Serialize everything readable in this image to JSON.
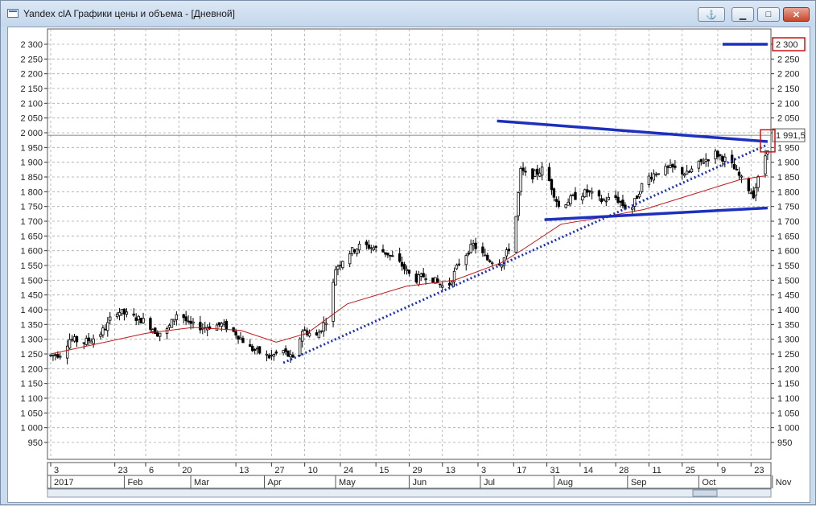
{
  "window": {
    "title": "Yandex clA Графики цены и объема - [Дневной]",
    "buttons": {
      "anchor": "⚓",
      "minimize": "▁",
      "maximize": "□",
      "close": "✕"
    }
  },
  "chart_data": {
    "type": "candlestick",
    "title": "",
    "ylim": [
      950,
      2300
    ],
    "yticks": [
      "2 300",
      "2 250",
      "2 200",
      "2 150",
      "2 100",
      "2 050",
      "2 000",
      "1 950",
      "1 900",
      "1 850",
      "1 800",
      "1 750",
      "1 700",
      "1 650",
      "1 600",
      "1 550",
      "1 500",
      "1 450",
      "1 400",
      "1 350",
      "1 300",
      "1 250",
      "1 200",
      "1 150",
      "1 100",
      "1 050",
      "1 000",
      "950"
    ],
    "ytick_values": [
      2300,
      2250,
      2200,
      2150,
      2100,
      2050,
      2000,
      1950,
      1900,
      1850,
      1800,
      1750,
      1700,
      1650,
      1600,
      1550,
      1500,
      1450,
      1400,
      1350,
      1300,
      1250,
      1200,
      1150,
      1100,
      1050,
      1000,
      950
    ],
    "x_day_labels": [
      "3",
      "23",
      "6",
      "20",
      "13",
      "27",
      "10",
      "24",
      "15",
      "29",
      "13",
      "3",
      "17",
      "31",
      "14",
      "28",
      "11",
      "25",
      "9",
      "23"
    ],
    "x_month_labels": [
      "2017",
      "Feb",
      "Mar",
      "Apr",
      "May",
      "Jun",
      "Jul",
      "Aug",
      "Sep",
      "Oct",
      "Nov"
    ],
    "price_readouts": [
      {
        "label": "1 991,5",
        "value": 1991.5
      },
      {
        "label": "2 300",
        "value": 2300
      }
    ],
    "close_path": [
      {
        "d": 0,
        "v": 1245
      },
      {
        "d": 4,
        "v": 1250
      },
      {
        "d": 8,
        "v": 1300
      },
      {
        "d": 14,
        "v": 1290
      },
      {
        "d": 20,
        "v": 1310
      },
      {
        "d": 24,
        "v": 1350
      },
      {
        "d": 27,
        "v": 1400
      },
      {
        "d": 33,
        "v": 1380
      },
      {
        "d": 40,
        "v": 1360
      },
      {
        "d": 45,
        "v": 1320
      },
      {
        "d": 49,
        "v": 1330
      },
      {
        "d": 54,
        "v": 1400
      },
      {
        "d": 58,
        "v": 1350
      },
      {
        "d": 64,
        "v": 1340
      },
      {
        "d": 72,
        "v": 1350
      },
      {
        "d": 78,
        "v": 1320
      },
      {
        "d": 84,
        "v": 1270
      },
      {
        "d": 92,
        "v": 1240
      },
      {
        "d": 98,
        "v": 1260
      },
      {
        "d": 102,
        "v": 1230
      },
      {
        "d": 106,
        "v": 1330
      },
      {
        "d": 112,
        "v": 1310
      },
      {
        "d": 117,
        "v": 1380
      },
      {
        "d": 120,
        "v": 1540
      },
      {
        "d": 125,
        "v": 1590
      },
      {
        "d": 131,
        "v": 1620
      },
      {
        "d": 136,
        "v": 1610
      },
      {
        "d": 142,
        "v": 1590
      },
      {
        "d": 148,
        "v": 1550
      },
      {
        "d": 153,
        "v": 1500
      },
      {
        "d": 159,
        "v": 1520
      },
      {
        "d": 163,
        "v": 1490
      },
      {
        "d": 167,
        "v": 1470
      },
      {
        "d": 172,
        "v": 1560
      },
      {
        "d": 178,
        "v": 1620
      },
      {
        "d": 184,
        "v": 1570
      },
      {
        "d": 190,
        "v": 1560
      },
      {
        "d": 195,
        "v": 1640
      },
      {
        "d": 198,
        "v": 1870
      },
      {
        "d": 202,
        "v": 1850
      },
      {
        "d": 208,
        "v": 1880
      },
      {
        "d": 214,
        "v": 1750
      },
      {
        "d": 220,
        "v": 1780
      },
      {
        "d": 226,
        "v": 1800
      },
      {
        "d": 232,
        "v": 1770
      },
      {
        "d": 238,
        "v": 1780
      },
      {
        "d": 244,
        "v": 1730
      },
      {
        "d": 250,
        "v": 1840
      },
      {
        "d": 256,
        "v": 1870
      },
      {
        "d": 262,
        "v": 1880
      },
      {
        "d": 268,
        "v": 1860
      },
      {
        "d": 274,
        "v": 1900
      },
      {
        "d": 280,
        "v": 1930
      },
      {
        "d": 286,
        "v": 1900
      },
      {
        "d": 292,
        "v": 1830
      },
      {
        "d": 296,
        "v": 1790
      },
      {
        "d": 299,
        "v": 1870
      },
      {
        "d": 302,
        "v": 1950
      }
    ],
    "ma_path": [
      {
        "d": 0,
        "v": 1250
      },
      {
        "d": 20,
        "v": 1285
      },
      {
        "d": 40,
        "v": 1320
      },
      {
        "d": 60,
        "v": 1340
      },
      {
        "d": 80,
        "v": 1330
      },
      {
        "d": 95,
        "v": 1290
      },
      {
        "d": 108,
        "v": 1320
      },
      {
        "d": 125,
        "v": 1420
      },
      {
        "d": 150,
        "v": 1480
      },
      {
        "d": 170,
        "v": 1500
      },
      {
        "d": 190,
        "v": 1560
      },
      {
        "d": 200,
        "v": 1610
      },
      {
        "d": 215,
        "v": 1690
      },
      {
        "d": 230,
        "v": 1710
      },
      {
        "d": 250,
        "v": 1740
      },
      {
        "d": 270,
        "v": 1790
      },
      {
        "d": 290,
        "v": 1840
      },
      {
        "d": 302,
        "v": 1855
      }
    ],
    "trendlines": [
      {
        "name": "upper-resistance",
        "style": "solid",
        "from": {
          "d": 188,
          "v": 2040
        },
        "to": {
          "d": 302,
          "v": 1970
        }
      },
      {
        "name": "lower-support",
        "style": "solid",
        "from": {
          "d": 208,
          "v": 1705
        },
        "to": {
          "d": 302,
          "v": 1745
        }
      },
      {
        "name": "rising-support",
        "style": "dotted",
        "from": {
          "d": 98,
          "v": 1220
        },
        "to": {
          "d": 302,
          "v": 1960
        }
      },
      {
        "name": "target-level",
        "style": "solid",
        "from": {
          "d": 283,
          "v": 2300
        },
        "to": {
          "d": 302,
          "v": 2300
        }
      }
    ],
    "colors": {
      "trendline": "#1c2fbd",
      "moving_average": "#c01818",
      "candles": "#000000",
      "highlight_box": "#d01010",
      "grid": "#a8a8a8"
    },
    "grid": true
  }
}
